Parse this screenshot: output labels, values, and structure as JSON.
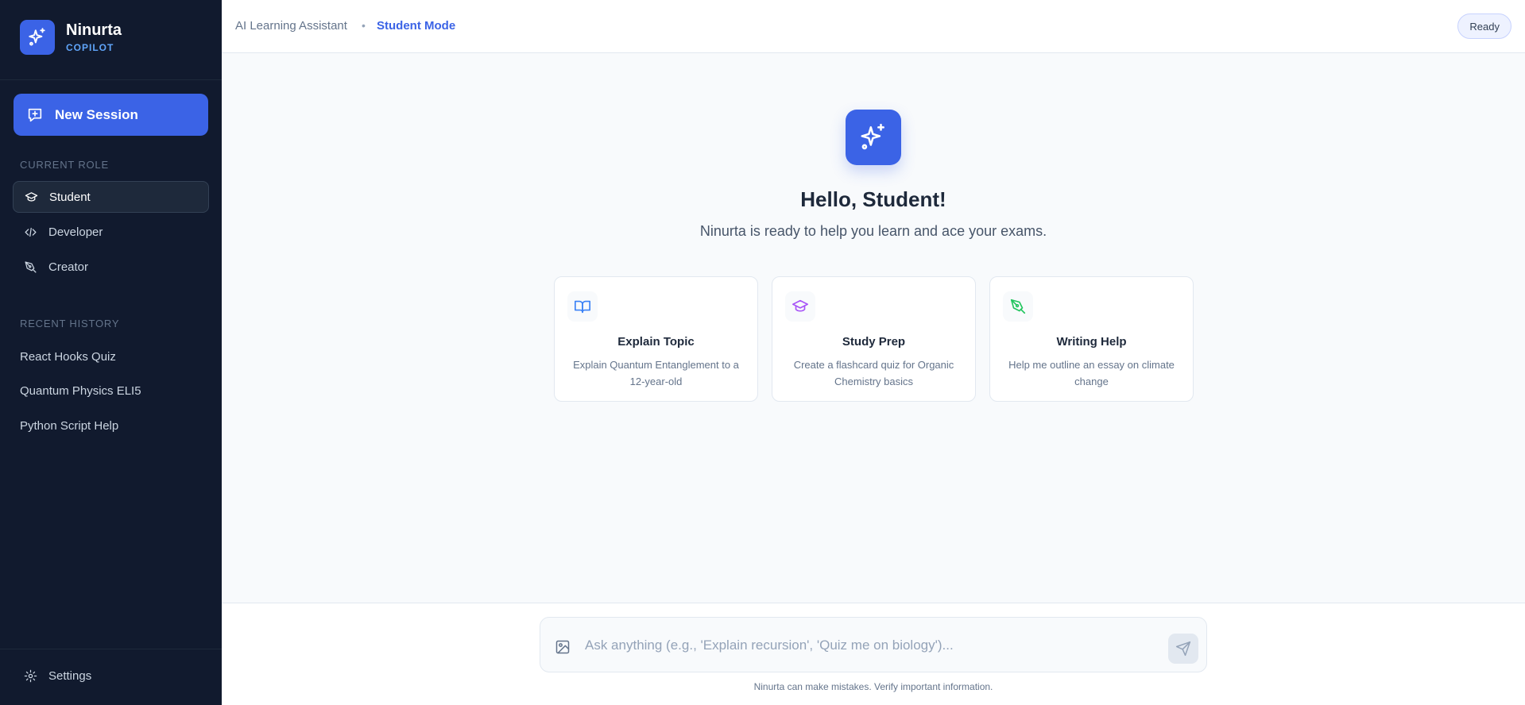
{
  "brand": {
    "name": "Ninurta",
    "subtitle": "COPILOT",
    "logo_icon": "sparkles-icon"
  },
  "sidebar": {
    "new_session_label": "New Session",
    "current_role_label": "CURRENT ROLE",
    "roles": [
      {
        "label": "Student",
        "icon": "graduation-cap-icon",
        "active": true
      },
      {
        "label": "Developer",
        "icon": "code-icon",
        "active": false
      },
      {
        "label": "Creator",
        "icon": "pen-tool-icon",
        "active": false
      }
    ],
    "recent_history_label": "RECENT HISTORY",
    "history": [
      {
        "label": "React Hooks Quiz"
      },
      {
        "label": "Quantum Physics ELI5"
      },
      {
        "label": "Python Script Help"
      }
    ],
    "settings_label": "Settings"
  },
  "header": {
    "breadcrumb_app": "AI Learning Assistant",
    "breadcrumb_separator": "•",
    "breadcrumb_mode": "Student Mode",
    "status": "Ready"
  },
  "main": {
    "greeting": "Hello, Student!",
    "subtitle": "Ninurta is ready to help you learn and ace your exams.",
    "cards": [
      {
        "title": "Explain Topic",
        "description": "Explain Quantum Entanglement to a 12-year-old",
        "icon": "book-open-icon",
        "color": "#3b82f6"
      },
      {
        "title": "Study Prep",
        "description": "Create a flashcard quiz for Organic Chemistry basics",
        "icon": "graduation-cap-icon",
        "color": "#a855f7"
      },
      {
        "title": "Writing Help",
        "description": "Help me outline an essay on climate change",
        "icon": "pen-tool-icon",
        "color": "#22c55e"
      }
    ]
  },
  "composer": {
    "placeholder": "Ask anything (e.g., 'Explain recursion', 'Quiz me on biology')...",
    "value": "",
    "disclaimer": "Ninurta can make mistakes. Verify important information."
  },
  "colors": {
    "accent": "#3b63e6",
    "sidebar_bg": "#111a2e"
  }
}
